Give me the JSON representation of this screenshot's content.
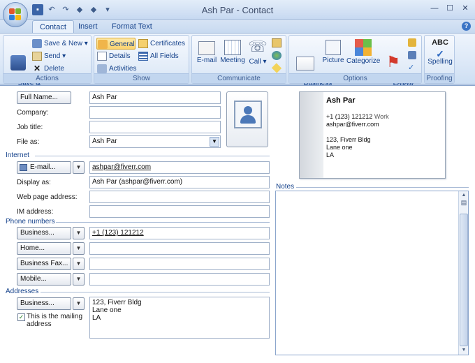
{
  "window": {
    "title": "Ash Par - Contact"
  },
  "tabs": [
    {
      "label": "Contact"
    },
    {
      "label": "Insert"
    },
    {
      "label": "Format Text"
    }
  ],
  "ribbon": {
    "actions": {
      "label": "Actions",
      "save_close": "Save &\nClose",
      "save_new": "Save & New",
      "send": "Send",
      "delete": "Delete"
    },
    "show": {
      "label": "Show",
      "general": "General",
      "details": "Details",
      "activities": "Activities",
      "certificates": "Certificates",
      "all_fields": "All Fields"
    },
    "communicate": {
      "label": "Communicate",
      "email": "E-mail",
      "meeting": "Meeting",
      "call": "Call"
    },
    "options": {
      "label": "Options",
      "business_card": "Business\nCard",
      "picture": "Picture",
      "categorize": "Categorize",
      "follow_up": "Follow\nUp"
    },
    "proofing": {
      "label": "Proofing",
      "spelling": "Spelling"
    }
  },
  "form": {
    "full_name": {
      "button": "Full Name...",
      "value": "Ash Par"
    },
    "company": {
      "label": "Company:",
      "value": ""
    },
    "job_title": {
      "label": "Job title:",
      "value": ""
    },
    "file_as": {
      "label": "File as:",
      "value": "Ash Par"
    },
    "internet": {
      "section": "Internet",
      "email_button": "E-mail...",
      "email_value": "ashpar@fiverr.com",
      "display_as_label": "Display as:",
      "display_as_value": "Ash Par (ashpar@fiverr.com)",
      "web_label": "Web page address:",
      "web_value": "",
      "im_label": "IM address:",
      "im_value": ""
    },
    "phones": {
      "section": "Phone numbers",
      "rows": [
        {
          "button": "Business...",
          "value": "+1 (123) 121212"
        },
        {
          "button": "Home...",
          "value": ""
        },
        {
          "button": "Business Fax...",
          "value": ""
        },
        {
          "button": "Mobile...",
          "value": ""
        }
      ]
    },
    "addresses": {
      "section": "Addresses",
      "button": "Business...",
      "value": "123, Fiverr Bldg\nLane one\nLA",
      "mailing_checkbox": "This is the mailing\naddress",
      "mailing_checked": true
    },
    "notes_label": "Notes"
  },
  "business_card": {
    "name": "Ash Par",
    "phone": "+1 (123) 121212",
    "phone_type": "Work",
    "email": "ashpar@fiverr.com",
    "address1": "123, Fiverr Bldg",
    "address2": "Lane one",
    "address3": "LA"
  }
}
